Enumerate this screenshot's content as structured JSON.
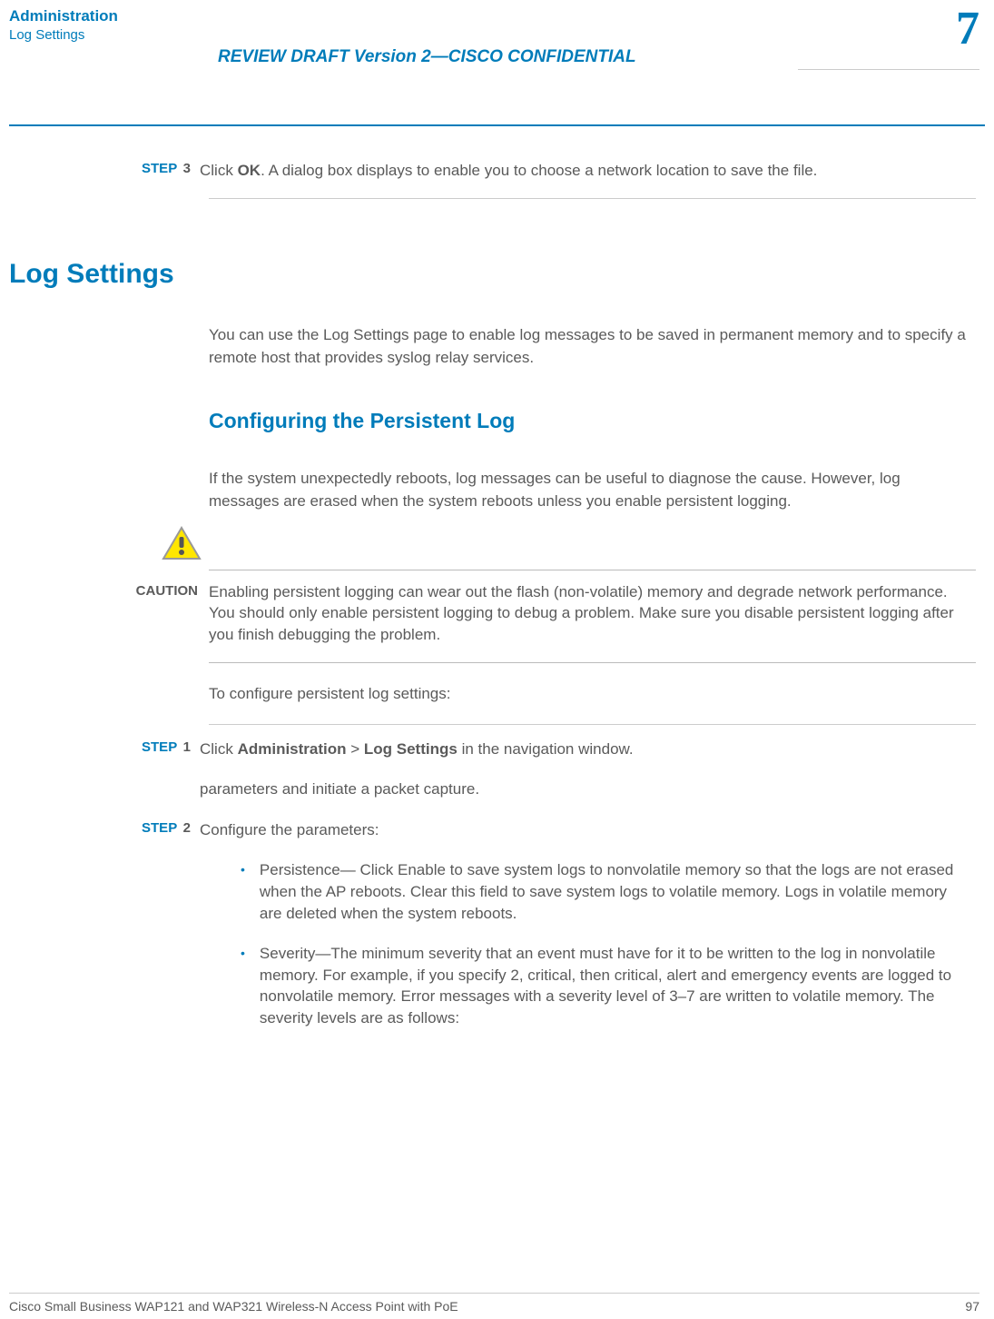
{
  "header": {
    "title": "Administration",
    "subtitle": "Log Settings",
    "review": "REVIEW DRAFT  Version 2—CISCO CONFIDENTIAL",
    "chapter": "7"
  },
  "step3": {
    "label": "STEP",
    "num": "3",
    "pre": "Click ",
    "bold": "OK",
    "post": ". A dialog box displays to enable you to choose a network location to save the file."
  },
  "h1": "Log Settings",
  "intro_pre": "You can use the ",
  "intro_bold": "Log Settings",
  "intro_post": " page to enable log messages to be saved in permanent memory and to specify a remote host that provides syslog relay services.",
  "h2": "Configuring the Persistent Log",
  "p1": "If the system unexpectedly reboots, log messages can be useful to diagnose the cause. However, log messages are erased when the system reboots unless you enable persistent logging.",
  "caution": {
    "label": "CAUTION",
    "text": "Enabling persistent logging can wear out the flash (non-volatile) memory and degrade network performance. You should only enable persistent logging to debug a problem. Make sure you disable persistent logging after you finish debugging the problem."
  },
  "p2": "To configure persistent log settings:",
  "step1": {
    "label": "STEP",
    "num": "1",
    "pre": "Click ",
    "bold1": "Administration",
    "mid": " > ",
    "bold2": "Log Settings",
    "post": " in the navigation window.",
    "line2": "parameters and initiate a packet capture."
  },
  "step2": {
    "label": "STEP",
    "num": "2",
    "text": "Configure the parameters:"
  },
  "bullets": {
    "b1": {
      "bold": "Persistence",
      "dash": "— Click ",
      "bold2": "Enable",
      "post": " to save system logs to nonvolatile memory so that the logs are not erased when the AP reboots. Clear this field to save system logs to volatile memory. Logs in volatile memory are deleted when the system reboots."
    },
    "b2": {
      "bold": "Severity",
      "post": "—The minimum severity that an event must have for it to be written to the log in nonvolatile memory. For example, if you specify 2, critical, then critical, alert and emergency events are logged to nonvolatile memory. Error messages with a severity level of 3–7 are written to volatile memory. The severity levels are as follows:"
    }
  },
  "footer": {
    "left": "Cisco Small Business WAP121 and WAP321 Wireless-N Access Point with PoE",
    "right": "97"
  }
}
